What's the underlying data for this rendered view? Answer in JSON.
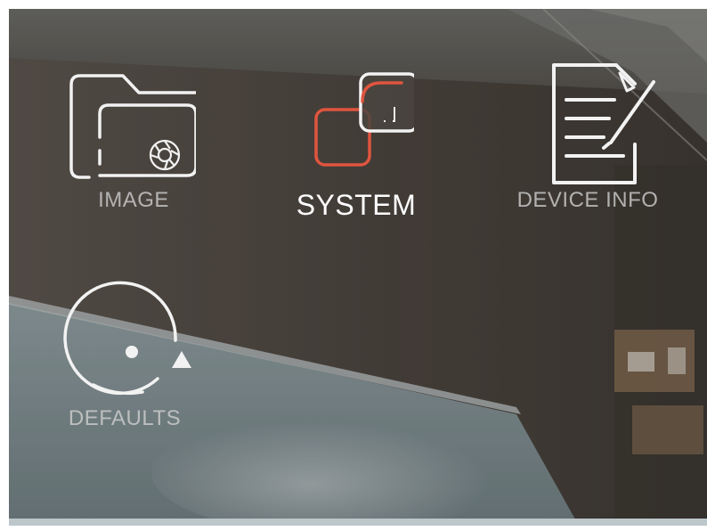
{
  "menu": {
    "selected": "system",
    "items": [
      {
        "id": "image",
        "label": "IMAGE",
        "icon": "folder-camera-icon"
      },
      {
        "id": "system",
        "label": "SYSTEM",
        "icon": "system-squares-icon"
      },
      {
        "id": "device_info",
        "label": "DEVICE INFO",
        "icon": "document-edit-icon"
      },
      {
        "id": "defaults",
        "label": "DEFAULTS",
        "icon": "reset-arrow-icon"
      }
    ]
  },
  "colors": {
    "accent": "#e0553f",
    "icon_normal": "#f2f2f2",
    "label_normal": "#cdcdcd",
    "label_selected": "#ffffff"
  }
}
